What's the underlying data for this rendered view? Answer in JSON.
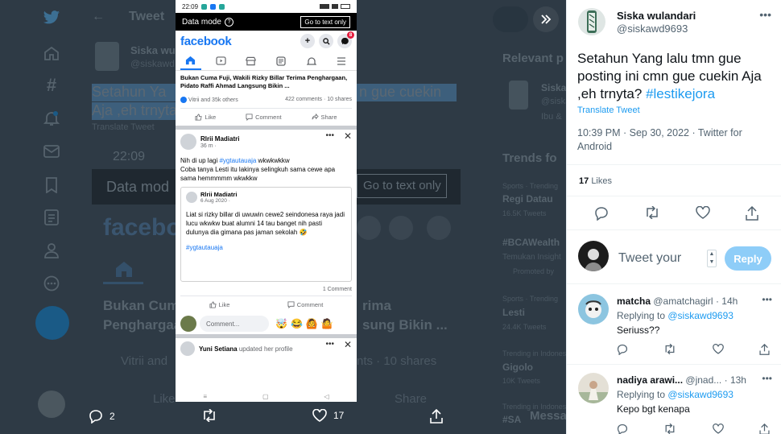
{
  "backdrop": {
    "header_title": "Tweet",
    "author_name": "Siska wu",
    "author_handle": "@siskawd",
    "tweet_fragment_1": "Setahun Ya",
    "tweet_fragment_2": "Aja ,eh trnyta",
    "tweet_fragment_right": "n gue cuekin",
    "translate_fragment": "Translate Tweet",
    "relevant_people": "Relevant p",
    "relevant_name": "Siska",
    "relevant_handle": "@siska",
    "relevant_bio": "Ibu &",
    "trends_title": "Trends fo",
    "trends": [
      {
        "context": "Sports · Trending",
        "name": "Regi Datau",
        "count": "16.5K Tweets"
      },
      {
        "context": "",
        "name": "#BCAWealth",
        "count": "Temukan Insight",
        "extra": "Promoted by"
      },
      {
        "context": "Sports · Trending",
        "name": "Lesti",
        "count": "24.4K Tweets"
      },
      {
        "context": "Trending in Indonesia",
        "name": "Gigolo",
        "count": "10K Tweets"
      },
      {
        "context": "Trending in Indonesia",
        "name": "#SA",
        "count": ""
      }
    ],
    "messages_fragment": "Messa",
    "phone_bg_fragments": {
      "time": "22:09",
      "datamode": "Data mod",
      "gototext": "Go to text only",
      "facebook": "facebook",
      "post_line1": "Bukan Cuma",
      "post_line1_right": "rima",
      "post_line2": "Penghargaa",
      "post_line2_right": "sung Bikin ...",
      "reactions": "Vitrii and",
      "shares": "nts · 10 shares",
      "like": "Like",
      "share": "Share"
    }
  },
  "phone": {
    "status_time": "22:09",
    "datamode_label": "Data mode",
    "datamode_button": "Go to text only",
    "logo": "facebook",
    "notif_count": "8",
    "post1": {
      "text": "Bukan Cuma Fuji, Wakili Rizky Billar Terima Penghargaan, Pidato Raffi Ahmad Langsung Bikin ...",
      "reactions": "Vitrii and 35k others",
      "stats": "422 comments · 10 shares",
      "like": "Like",
      "comment": "Comment",
      "share": "Share"
    },
    "post2": {
      "author": "Rlrii Madiatri",
      "time": "36 m ·",
      "text_pre": "Nih di up lagi ",
      "hashtag": "#ygtautauaja",
      "text_post": " wkwkwkkw",
      "text_line2": "Coba tanya Lesti itu lakinya selingkuh sama cewe apa sama hemmmmm wkwkkw",
      "shared_author": "Rlrii Madiatri",
      "shared_date": "6 Aug 2020 ·",
      "shared_text": "Liat si rizky billar di uwuwin cewe2 seindonesa raya jadi lucu wkwkw buat alumni 14 tau banget nih pasti dulunya dia gimana pas jaman sekolah 🤣",
      "shared_hashtag": "#ygtautauaja",
      "comment_count": "1 Comment",
      "like": "Like",
      "comment": "Comment",
      "comment_placeholder": "Comment..."
    },
    "post3": {
      "author": "Yuni Setiana",
      "action": "updated her profile"
    }
  },
  "media_bar": {
    "reply_count": "2",
    "like_count": "17"
  },
  "tweet": {
    "author_name": "Siska wulandari",
    "author_handle": "@siskawd9693",
    "text": "Setahun Yang lalu tmn gue posting ini cmn gue cuekin Aja ,eh trnyta? ",
    "hashtag": "#lestikejora",
    "translate": "Translate Tweet",
    "timestamp": "10:39 PM · Sep 30, 2022 · Twitter for Android",
    "likes_count": "17",
    "likes_label": "Likes",
    "reply_placeholder": "Tweet your",
    "reply_button": "Reply"
  },
  "replies": [
    {
      "name": "matcha",
      "handle": "@amatchagirl",
      "time": "· 14h",
      "replying_label": "Replying to ",
      "replying_to": "@siskawd9693",
      "text": "Seriuss??"
    },
    {
      "name": "nadiya arawi...",
      "handle": "@jnad...",
      "time": "· 13h",
      "replying_label": "Replying to ",
      "replying_to": "@siskawd9693",
      "text": "Kepo bgt kenapa"
    }
  ],
  "colors": {
    "accent": "#1d9bf0",
    "reply_button": "#8ecdf8",
    "facebook_blue": "#1877f2",
    "backdrop": "#2e3a45"
  }
}
